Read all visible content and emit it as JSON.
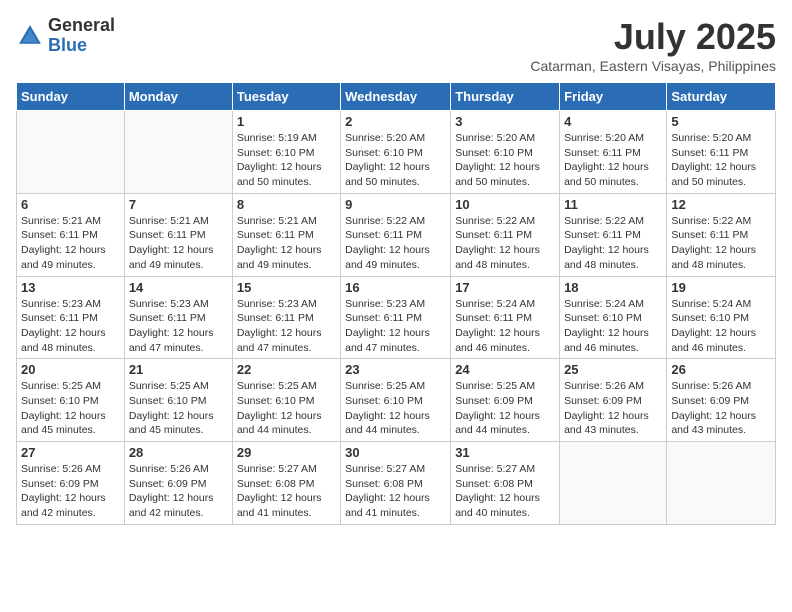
{
  "logo": {
    "general": "General",
    "blue": "Blue"
  },
  "title": "July 2025",
  "location": "Catarman, Eastern Visayas, Philippines",
  "days_of_week": [
    "Sunday",
    "Monday",
    "Tuesday",
    "Wednesday",
    "Thursday",
    "Friday",
    "Saturday"
  ],
  "weeks": [
    [
      {
        "day": "",
        "info": ""
      },
      {
        "day": "",
        "info": ""
      },
      {
        "day": "1",
        "info": "Sunrise: 5:19 AM\nSunset: 6:10 PM\nDaylight: 12 hours and 50 minutes."
      },
      {
        "day": "2",
        "info": "Sunrise: 5:20 AM\nSunset: 6:10 PM\nDaylight: 12 hours and 50 minutes."
      },
      {
        "day": "3",
        "info": "Sunrise: 5:20 AM\nSunset: 6:10 PM\nDaylight: 12 hours and 50 minutes."
      },
      {
        "day": "4",
        "info": "Sunrise: 5:20 AM\nSunset: 6:11 PM\nDaylight: 12 hours and 50 minutes."
      },
      {
        "day": "5",
        "info": "Sunrise: 5:20 AM\nSunset: 6:11 PM\nDaylight: 12 hours and 50 minutes."
      }
    ],
    [
      {
        "day": "6",
        "info": "Sunrise: 5:21 AM\nSunset: 6:11 PM\nDaylight: 12 hours and 49 minutes."
      },
      {
        "day": "7",
        "info": "Sunrise: 5:21 AM\nSunset: 6:11 PM\nDaylight: 12 hours and 49 minutes."
      },
      {
        "day": "8",
        "info": "Sunrise: 5:21 AM\nSunset: 6:11 PM\nDaylight: 12 hours and 49 minutes."
      },
      {
        "day": "9",
        "info": "Sunrise: 5:22 AM\nSunset: 6:11 PM\nDaylight: 12 hours and 49 minutes."
      },
      {
        "day": "10",
        "info": "Sunrise: 5:22 AM\nSunset: 6:11 PM\nDaylight: 12 hours and 48 minutes."
      },
      {
        "day": "11",
        "info": "Sunrise: 5:22 AM\nSunset: 6:11 PM\nDaylight: 12 hours and 48 minutes."
      },
      {
        "day": "12",
        "info": "Sunrise: 5:22 AM\nSunset: 6:11 PM\nDaylight: 12 hours and 48 minutes."
      }
    ],
    [
      {
        "day": "13",
        "info": "Sunrise: 5:23 AM\nSunset: 6:11 PM\nDaylight: 12 hours and 48 minutes."
      },
      {
        "day": "14",
        "info": "Sunrise: 5:23 AM\nSunset: 6:11 PM\nDaylight: 12 hours and 47 minutes."
      },
      {
        "day": "15",
        "info": "Sunrise: 5:23 AM\nSunset: 6:11 PM\nDaylight: 12 hours and 47 minutes."
      },
      {
        "day": "16",
        "info": "Sunrise: 5:23 AM\nSunset: 6:11 PM\nDaylight: 12 hours and 47 minutes."
      },
      {
        "day": "17",
        "info": "Sunrise: 5:24 AM\nSunset: 6:11 PM\nDaylight: 12 hours and 46 minutes."
      },
      {
        "day": "18",
        "info": "Sunrise: 5:24 AM\nSunset: 6:10 PM\nDaylight: 12 hours and 46 minutes."
      },
      {
        "day": "19",
        "info": "Sunrise: 5:24 AM\nSunset: 6:10 PM\nDaylight: 12 hours and 46 minutes."
      }
    ],
    [
      {
        "day": "20",
        "info": "Sunrise: 5:25 AM\nSunset: 6:10 PM\nDaylight: 12 hours and 45 minutes."
      },
      {
        "day": "21",
        "info": "Sunrise: 5:25 AM\nSunset: 6:10 PM\nDaylight: 12 hours and 45 minutes."
      },
      {
        "day": "22",
        "info": "Sunrise: 5:25 AM\nSunset: 6:10 PM\nDaylight: 12 hours and 44 minutes."
      },
      {
        "day": "23",
        "info": "Sunrise: 5:25 AM\nSunset: 6:10 PM\nDaylight: 12 hours and 44 minutes."
      },
      {
        "day": "24",
        "info": "Sunrise: 5:25 AM\nSunset: 6:09 PM\nDaylight: 12 hours and 44 minutes."
      },
      {
        "day": "25",
        "info": "Sunrise: 5:26 AM\nSunset: 6:09 PM\nDaylight: 12 hours and 43 minutes."
      },
      {
        "day": "26",
        "info": "Sunrise: 5:26 AM\nSunset: 6:09 PM\nDaylight: 12 hours and 43 minutes."
      }
    ],
    [
      {
        "day": "27",
        "info": "Sunrise: 5:26 AM\nSunset: 6:09 PM\nDaylight: 12 hours and 42 minutes."
      },
      {
        "day": "28",
        "info": "Sunrise: 5:26 AM\nSunset: 6:09 PM\nDaylight: 12 hours and 42 minutes."
      },
      {
        "day": "29",
        "info": "Sunrise: 5:27 AM\nSunset: 6:08 PM\nDaylight: 12 hours and 41 minutes."
      },
      {
        "day": "30",
        "info": "Sunrise: 5:27 AM\nSunset: 6:08 PM\nDaylight: 12 hours and 41 minutes."
      },
      {
        "day": "31",
        "info": "Sunrise: 5:27 AM\nSunset: 6:08 PM\nDaylight: 12 hours and 40 minutes."
      },
      {
        "day": "",
        "info": ""
      },
      {
        "day": "",
        "info": ""
      }
    ]
  ]
}
